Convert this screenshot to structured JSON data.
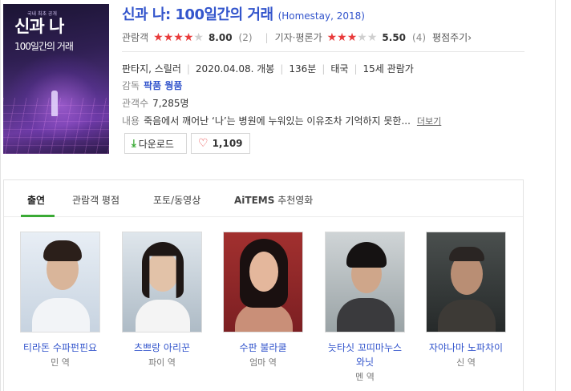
{
  "movie": {
    "title": "신과 나: 100일간의 거래",
    "subtitle": "(Homestay, 2018)",
    "poster": {
      "small_text": "국내 최초 공개",
      "title": "신과 나",
      "subtitle": "100일간의 거래"
    }
  },
  "ratings": {
    "audience_label": "관람객",
    "audience_score": "8.00",
    "audience_count": "(2)",
    "audience_stars": 4,
    "critic_label": "기자·평론가",
    "critic_score": "5.50",
    "critic_count": "(4)",
    "critic_stars": 3,
    "review_link": "평점주기›"
  },
  "meta": {
    "genre": "판타지, 스릴러",
    "release": "2020.04.08. 개봉",
    "runtime": "136분",
    "country": "태국",
    "age": "15세 관람가",
    "director_label": "감독",
    "director": "팍품 웡품",
    "audience_num_label": "관객수",
    "audience_num": "7,285명",
    "plot_label": "내용",
    "plot": "죽음에서 깨어난 ‘나’는 병원에 누워있는 이유조차 기억하지 못한...",
    "more_label": "더보기"
  },
  "buttons": {
    "download_label": "다운로드",
    "like_count": "1,109"
  },
  "tabs": [
    {
      "label": "출연"
    },
    {
      "label": "관람객 평점"
    },
    {
      "label": "포토/동영상"
    },
    {
      "label_bold": "AiTEMS",
      "label_rest": " 추천영화"
    }
  ],
  "cast": [
    {
      "name": "티라돈 수파펀핀요",
      "role": "민 역"
    },
    {
      "name": "츠쁘랑 아리꾼",
      "role": "파이 역"
    },
    {
      "name": "수판 불라쿨",
      "role": "엄마 역"
    },
    {
      "name": "늣타싯 꼬띠마누스와닛",
      "role": "멘 역"
    },
    {
      "name": "자야나마 노파차이",
      "role": "신 역"
    }
  ],
  "colors": {
    "link_blue": "#3355cc",
    "star_red": "#e83a3a",
    "tab_green": "#3aaa35"
  }
}
